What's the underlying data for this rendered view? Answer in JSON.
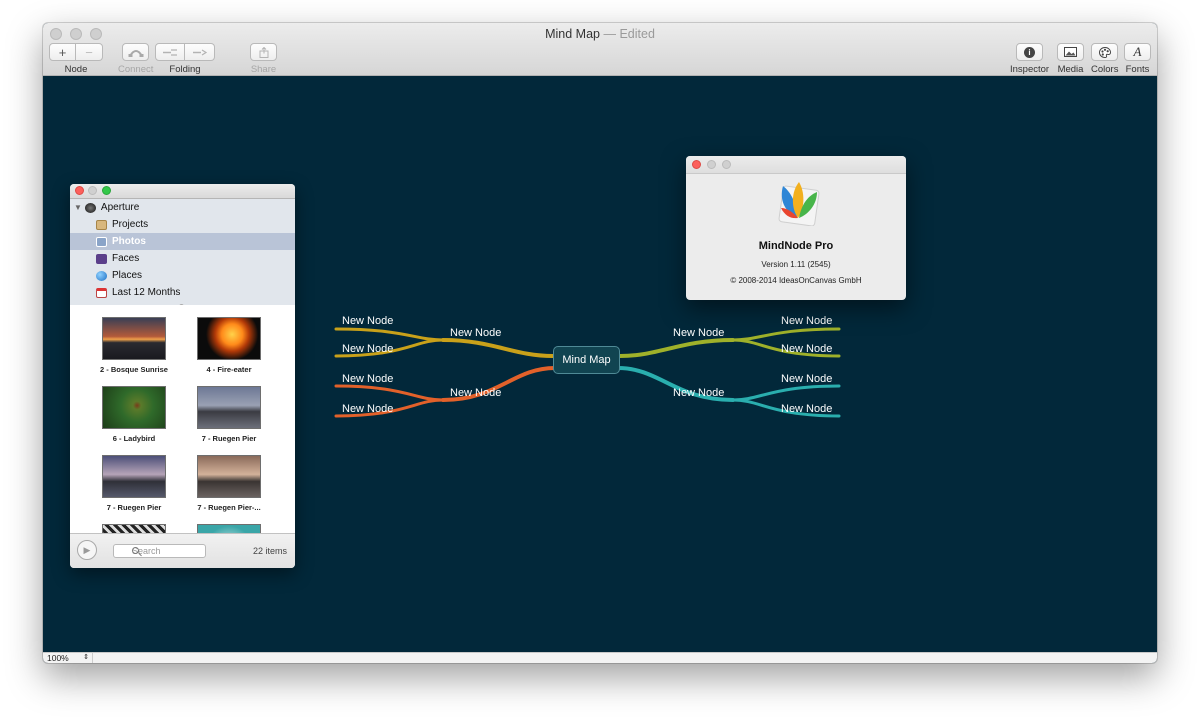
{
  "window": {
    "title": "Mind Map",
    "separator": "—",
    "status": "Edited"
  },
  "toolbar": {
    "node": {
      "label": "Node",
      "add_glyph": "+",
      "remove_glyph": "−"
    },
    "connect": {
      "label": "Connect"
    },
    "folding": {
      "label": "Folding"
    },
    "share": {
      "label": "Share"
    },
    "inspector": {
      "label": "Inspector",
      "glyph": "i"
    },
    "media": {
      "label": "Media"
    },
    "colors": {
      "label": "Colors"
    },
    "fonts": {
      "label": "Fonts",
      "glyph": "A"
    }
  },
  "status_bar": {
    "zoom": "100%",
    "stepper_glyph": "⇕"
  },
  "mindmap": {
    "central": {
      "label": "Mind Map"
    },
    "branches": [
      {
        "label": "New Node",
        "color": "#c9a11a",
        "children": [
          "New Node",
          "New Node"
        ]
      },
      {
        "label": "New Node",
        "color": "#e2612a",
        "children": [
          "New Node",
          "New Node"
        ]
      },
      {
        "label": "New Node",
        "color": "#9fb12a",
        "children": [
          "New Node",
          "New Node"
        ]
      },
      {
        "label": "New Node",
        "color": "#2aaeae",
        "children": [
          "New Node",
          "New Node"
        ]
      }
    ]
  },
  "aperture_panel": {
    "source_list": [
      {
        "label": "Aperture",
        "icon": "aperture-icon",
        "expanded": true
      },
      {
        "label": "Projects",
        "icon": "projects-icon"
      },
      {
        "label": "Photos",
        "icon": "photos-icon",
        "selected": true
      },
      {
        "label": "Faces",
        "icon": "faces-icon"
      },
      {
        "label": "Places",
        "icon": "places-globe-icon"
      },
      {
        "label": "Last 12 Months",
        "icon": "calendar-icon"
      }
    ],
    "thumbnails": [
      {
        "label": "2 - Bosque Sunrise"
      },
      {
        "label": "4 - Fire-eater"
      },
      {
        "label": "6 - Ladybird"
      },
      {
        "label": "7 - Ruegen Pier"
      },
      {
        "label": "7 - Ruegen Pier"
      },
      {
        "label": "7 - Ruegen Pier-..."
      }
    ],
    "search": {
      "placeholder": "Search"
    },
    "item_count": "22 items"
  },
  "about_dialog": {
    "app_name": "MindNode Pro",
    "version": "Version 1.11 (2545)",
    "copyright": "© 2008-2014 IdeasOnCanvas GmbH"
  }
}
